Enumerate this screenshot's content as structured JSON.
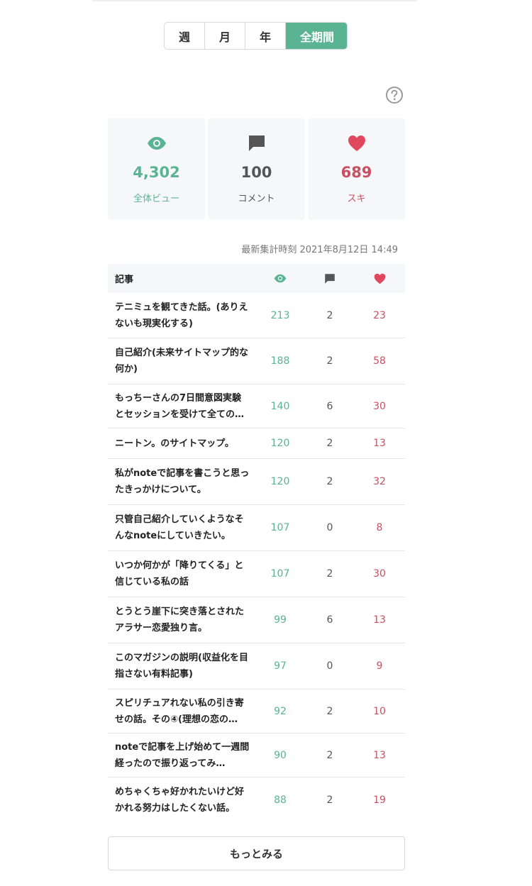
{
  "period_tabs": [
    {
      "label": "週",
      "active": false
    },
    {
      "label": "月",
      "active": false
    },
    {
      "label": "年",
      "active": false
    },
    {
      "label": "全期間",
      "active": true
    }
  ],
  "summary": {
    "views": {
      "value": "4,302",
      "label": "全体ビュー"
    },
    "comments": {
      "value": "100",
      "label": "コメント"
    },
    "likes": {
      "value": "689",
      "label": "スキ"
    }
  },
  "updated_at": "最新集計時刻 2021年8月12日 14:49",
  "table": {
    "header_title": "記事",
    "rows": [
      {
        "title": "テニミュを観てきた話。(ありえないも現実化する)",
        "views": "213",
        "comments": "2",
        "likes": "23"
      },
      {
        "title": "自己紹介(未来サイトマップ的な何か)",
        "views": "188",
        "comments": "2",
        "likes": "58"
      },
      {
        "title": "もっちーさんの7日間意図実験とセッションを受けて全ての…",
        "views": "140",
        "comments": "6",
        "likes": "30"
      },
      {
        "title": "ニートン。のサイトマップ。",
        "views": "120",
        "comments": "2",
        "likes": "13"
      },
      {
        "title": "私がnoteで記事を書こうと思ったきっかけについて。",
        "views": "120",
        "comments": "2",
        "likes": "32"
      },
      {
        "title": "只管自己紹介していくようなそんなnoteにしていきたい。",
        "views": "107",
        "comments": "0",
        "likes": "8"
      },
      {
        "title": "いつか何かが「降りてくる」と信じている私の話",
        "views": "107",
        "comments": "2",
        "likes": "30"
      },
      {
        "title": "とうとう崖下に突き落とされたアラサー恋愛独り言。",
        "views": "99",
        "comments": "6",
        "likes": "13"
      },
      {
        "title": "このマガジンの説明(収益化を目指さない有料記事)",
        "views": "97",
        "comments": "0",
        "likes": "9"
      },
      {
        "title": "スピリチュアれない私の引き寄せの話。その④(理想の恋の…",
        "views": "92",
        "comments": "2",
        "likes": "10"
      },
      {
        "title": "noteで記事を上げ始めて一週間経ったので振り返ってみ…",
        "views": "90",
        "comments": "2",
        "likes": "13"
      },
      {
        "title": "めちゃくちゃ好かれたいけど好かれる努力はしたくない話。",
        "views": "88",
        "comments": "2",
        "likes": "19"
      }
    ]
  },
  "more_button_label": "もっとみる",
  "icons": {
    "help": "help-circle-icon",
    "views": "eye-icon",
    "comments": "speech-bubble-icon",
    "likes": "heart-icon"
  },
  "colors": {
    "accent_green": "#5ab493",
    "like_red": "#c94f62",
    "heart_red": "#e0485d",
    "comment_gray": "#555555"
  }
}
